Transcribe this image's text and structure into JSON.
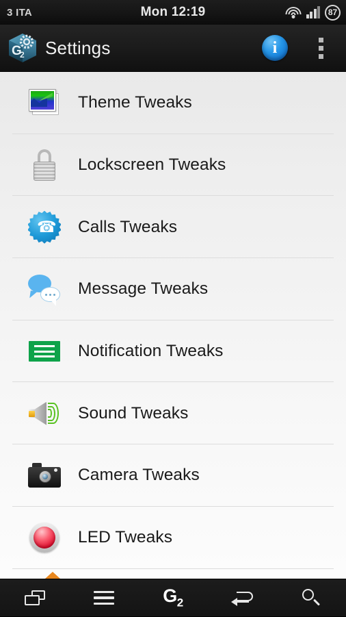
{
  "statusbar": {
    "carrier": "3 ITA",
    "clock": "Mon 12:19",
    "wifi_icon": "wifi-icon",
    "signal_icon": "signal-bars-icon",
    "battery_level": "87"
  },
  "actionbar": {
    "logo_icon": "g2-cube-logo-icon",
    "title": "Settings",
    "info_label": "i",
    "info_icon": "info-icon",
    "overflow_icon": "overflow-menu-icon"
  },
  "list": {
    "items": [
      {
        "label": "Theme Tweaks",
        "icon": "picture-icon"
      },
      {
        "label": "Lockscreen Tweaks",
        "icon": "padlock-icon"
      },
      {
        "label": "Calls Tweaks",
        "icon": "phone-badge-icon"
      },
      {
        "label": "Message Tweaks",
        "icon": "speech-bubbles-icon"
      },
      {
        "label": "Notification Tweaks",
        "icon": "notification-lines-icon"
      },
      {
        "label": "Sound Tweaks",
        "icon": "speaker-icon"
      },
      {
        "label": "Camera Tweaks",
        "icon": "camera-icon"
      },
      {
        "label": "LED Tweaks",
        "icon": "led-light-icon"
      }
    ],
    "scroll_indicator_icon": "scroll-up-arrow-icon"
  },
  "navbar": {
    "recents_icon": "recents-icon",
    "menu_icon": "menu-icon",
    "home_label": "G",
    "home_sub": "2",
    "home_icon": "g2-home-icon",
    "back_icon": "back-arrow-icon",
    "search_icon": "search-icon"
  },
  "colors": {
    "accent_blue": "#1e9ad8",
    "accent_green": "#0ea34a",
    "accent_orange": "#e8871e",
    "accent_red": "#e01030",
    "bar_dark": "#161616"
  }
}
